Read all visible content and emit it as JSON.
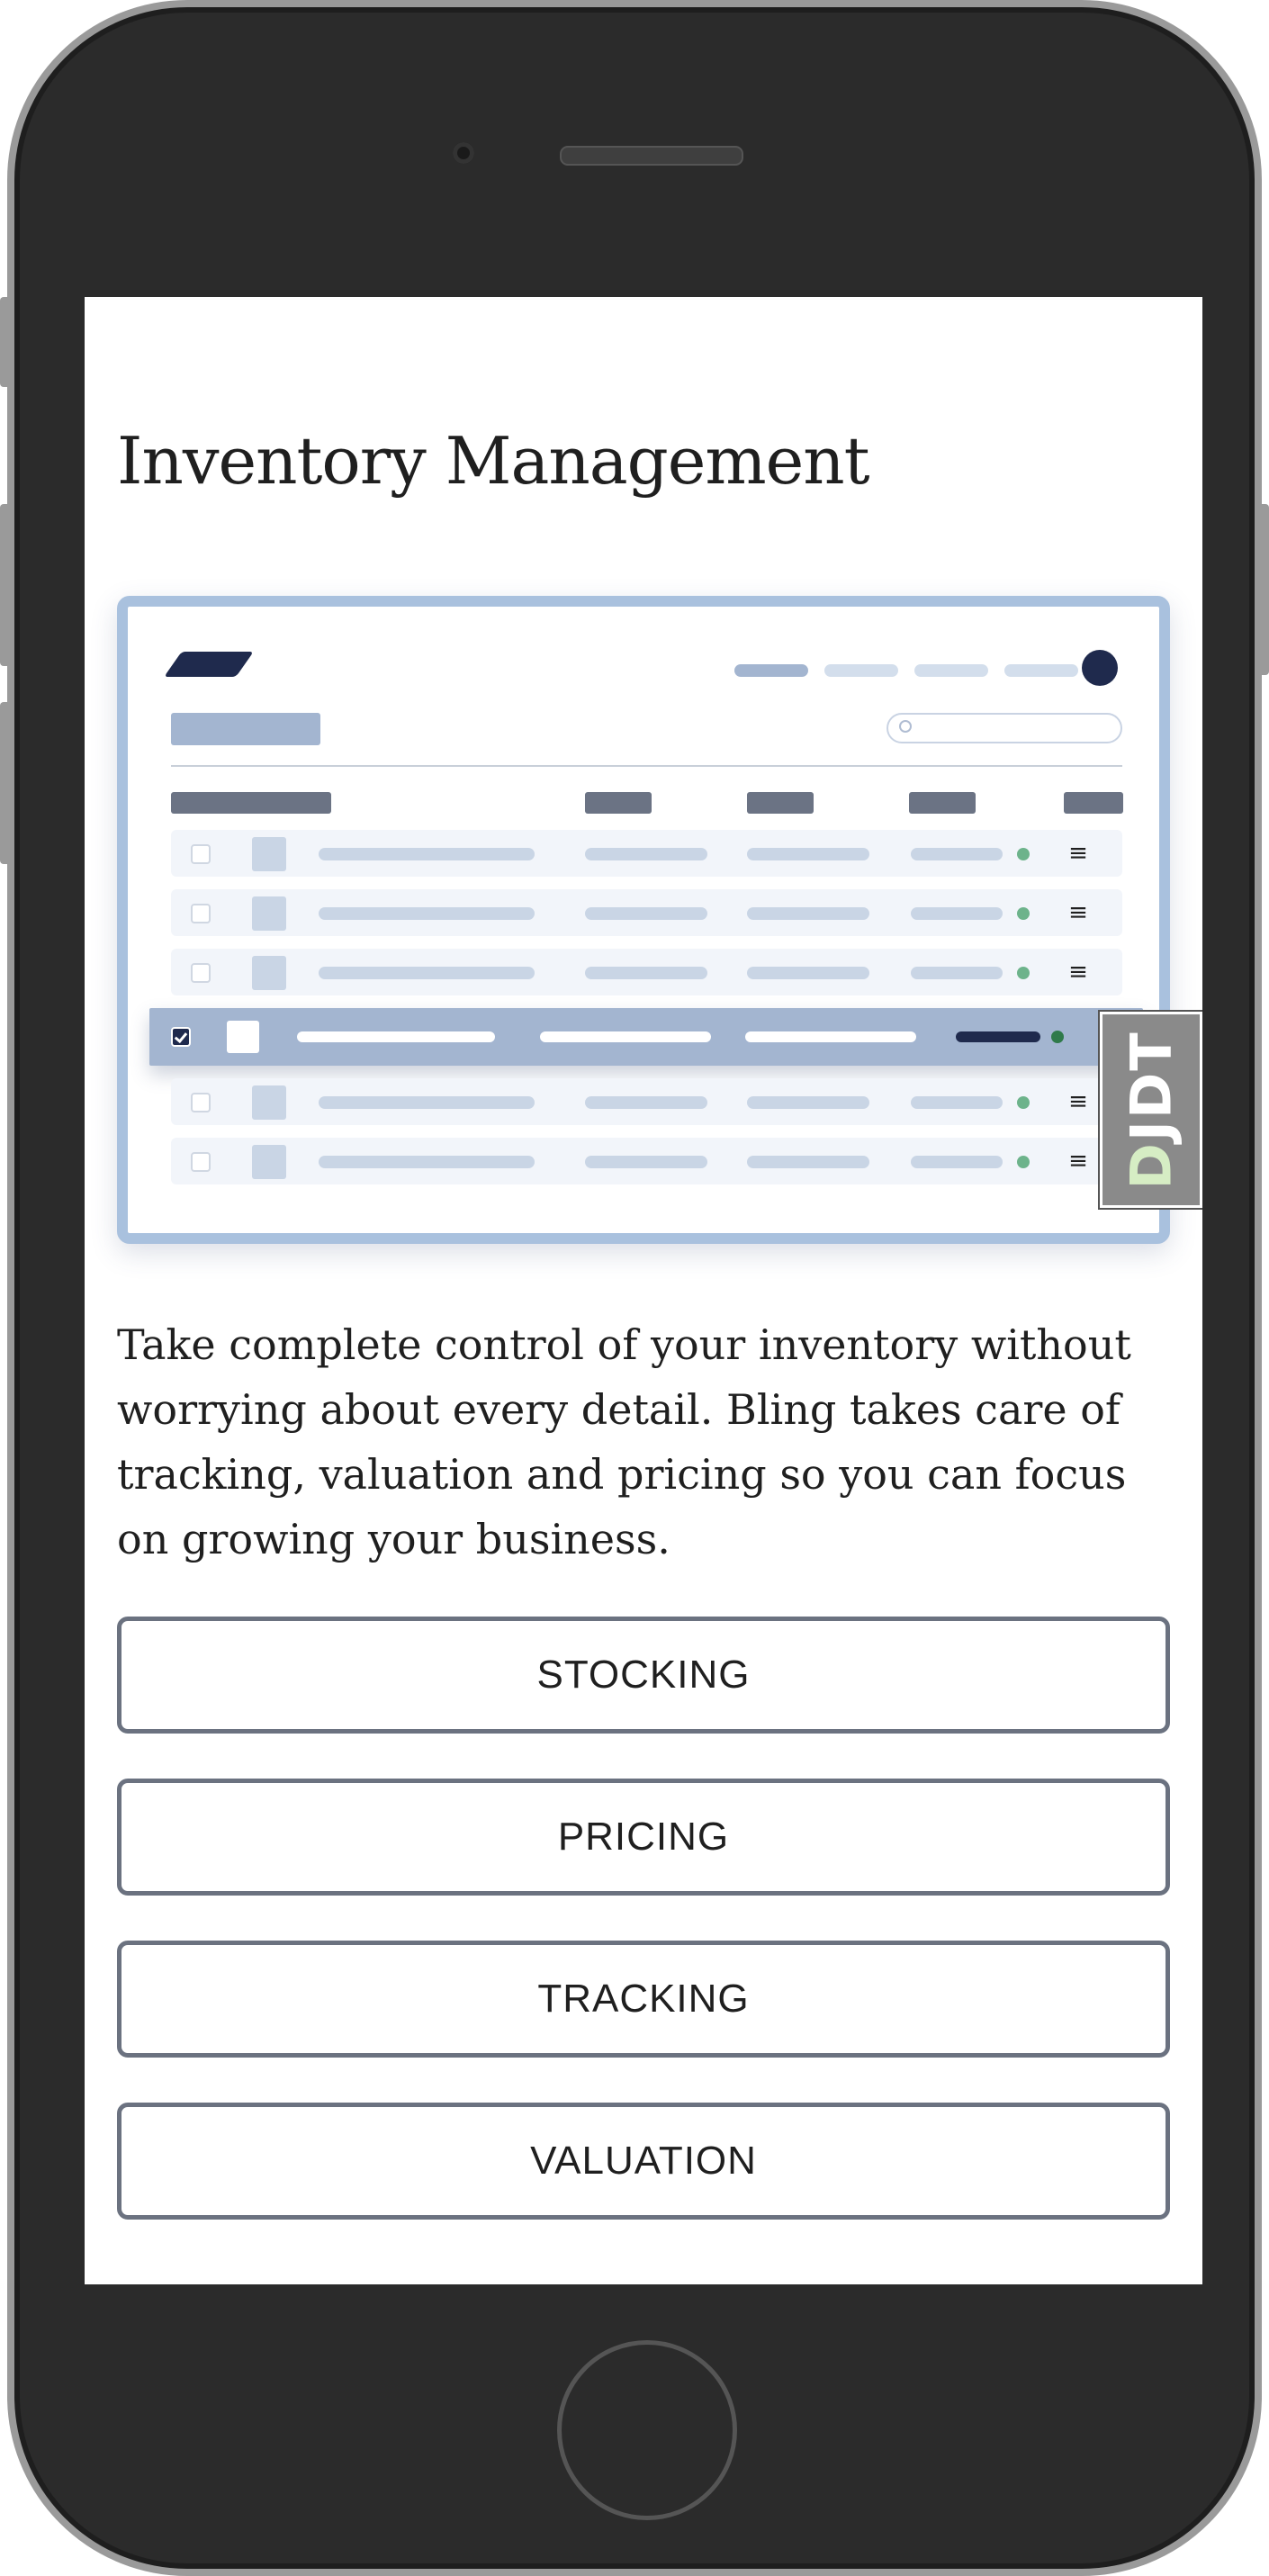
{
  "page": {
    "title": "Inventory Management",
    "description": "Take complete control of your inventory without worrying about every detail. Bling takes care of tracking, valuation and pricing so you can focus on growing your business."
  },
  "tabs": [
    {
      "label": "STOCKING"
    },
    {
      "label": "PRICING"
    },
    {
      "label": "TRACKING"
    },
    {
      "label": "VALUATION"
    }
  ],
  "mockup": {
    "selected_row": 4,
    "rows": 6,
    "row_menu_glyph": "≡"
  },
  "debug_toolbar": {
    "label_first": "D",
    "label_rest": "JDT"
  },
  "colors": {
    "accent_navy": "#1f2a4d",
    "mock_border": "#a9c1de",
    "status_green": "#6db38b"
  }
}
